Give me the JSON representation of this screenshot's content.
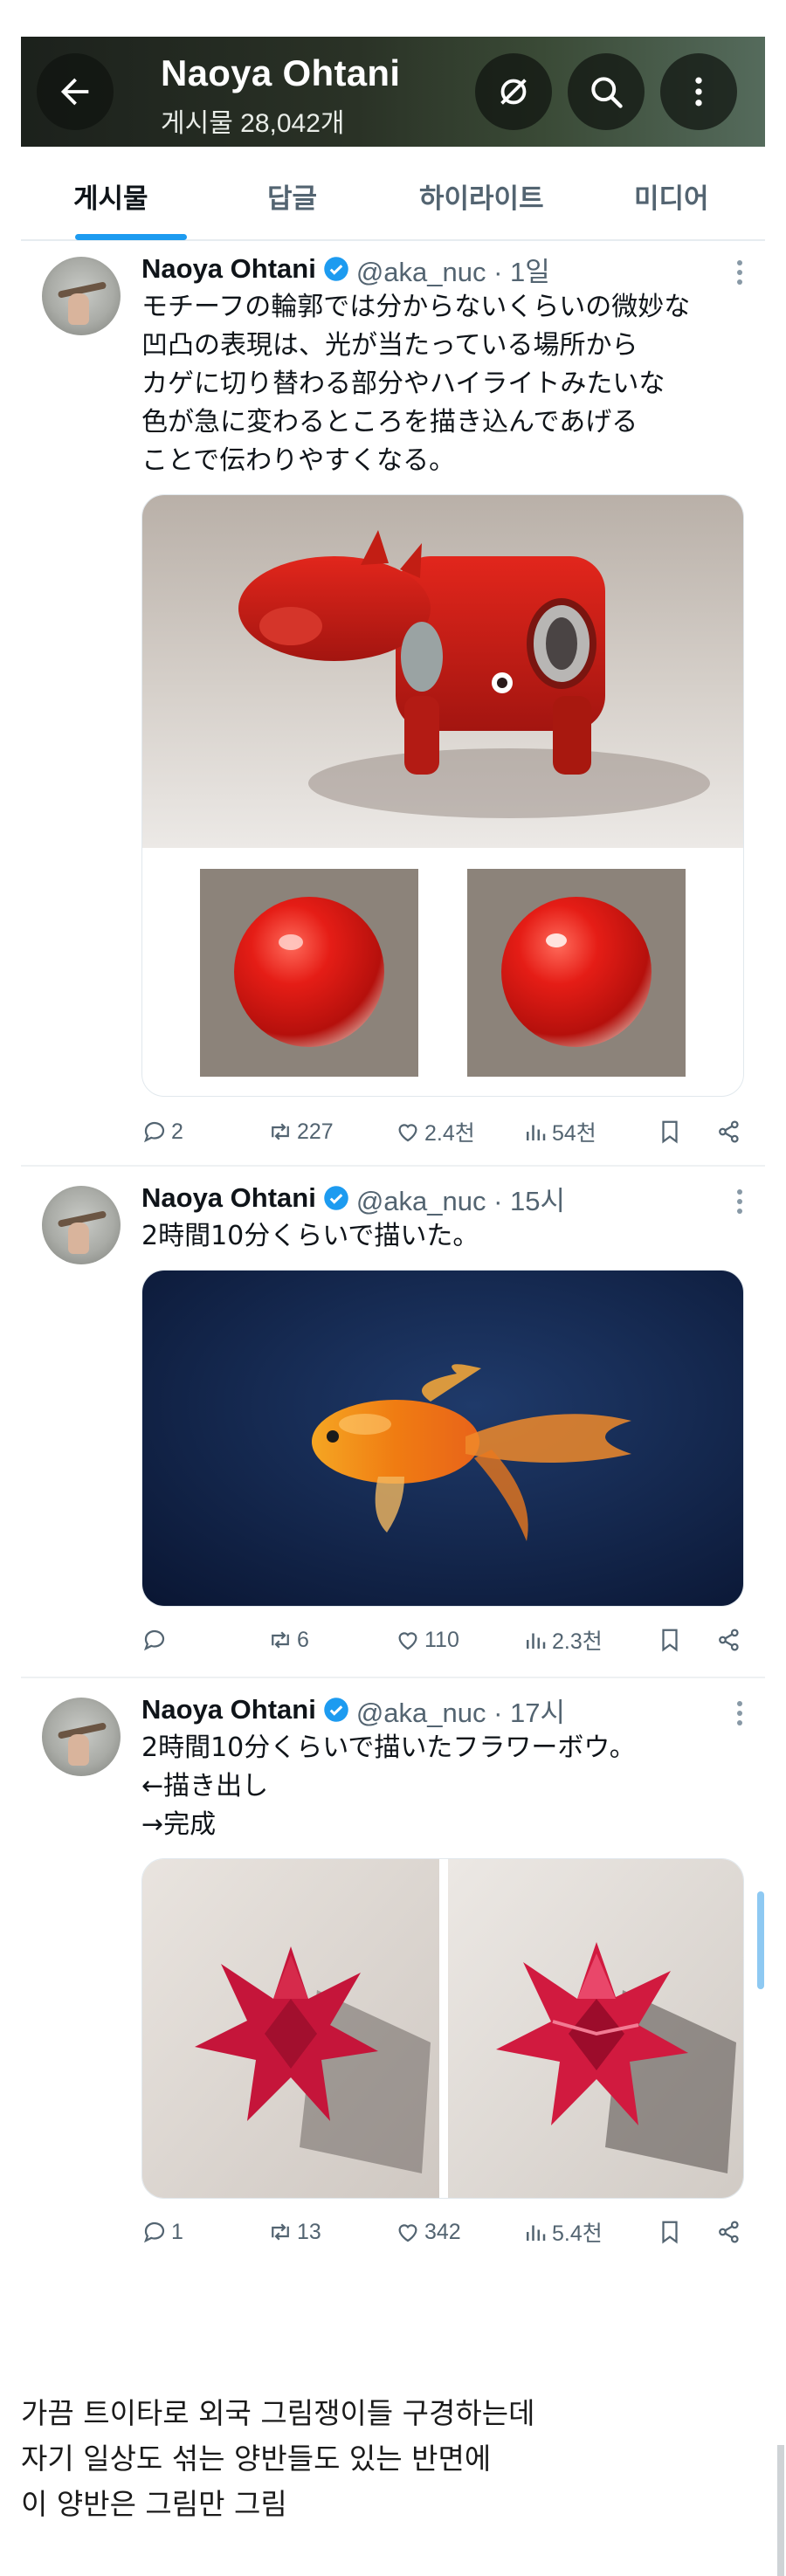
{
  "header": {
    "title": "Naoya Ohtani",
    "post_count": "게시물 28,042개",
    "icons": [
      "back-arrow-icon",
      "notifications-off-icon",
      "search-icon",
      "more-vertical-icon"
    ]
  },
  "tabs": [
    {
      "label": "게시물",
      "active": true
    },
    {
      "label": "답글",
      "active": false
    },
    {
      "label": "하이라이트",
      "active": false
    },
    {
      "label": "미디어",
      "active": false
    }
  ],
  "tweets": [
    {
      "name": "Naoya Ohtani",
      "handle": "@aka_nuc · 1일",
      "text": "モチーフの輪郭では分からないくらいの微妙な\n凹凸の表現は、光が当たっている場所から\nカゲに切り替わる部分やハイライトみたいな\n色が急に変わるところを描き込んであげる\nことで伝わりやすくなる。",
      "replies": "2",
      "retweets": "227",
      "likes": "2.4천",
      "views": "54천"
    },
    {
      "name": "Naoya Ohtani",
      "handle": "@aka_nuc · 15시",
      "text": "2時間10分くらいで描いた。",
      "replies": "",
      "retweets": "6",
      "likes": "110",
      "views": "2.3천"
    },
    {
      "name": "Naoya Ohtani",
      "handle": "@aka_nuc · 17시",
      "text": "2時間10分くらいで描いたフラワーボウ。\n←描き出し\n→完成",
      "replies": "1",
      "retweets": "13",
      "likes": "342",
      "views": "5.4천"
    }
  ],
  "caption": "가끔 트이타로 외국 그림쟁이들 구경하는데\n자기 일상도 섞는 양반들도 있는 반면에\n이 양반은 그림만 그림",
  "colors": {
    "accent": "#1d9bf0",
    "text": "#0f1419",
    "muted": "#536471"
  }
}
